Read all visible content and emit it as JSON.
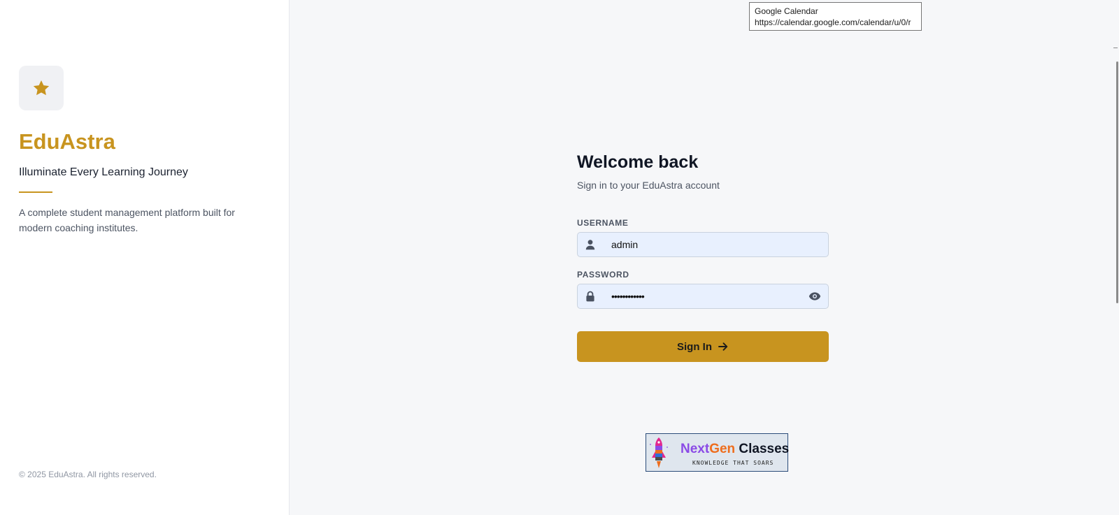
{
  "brand": {
    "logo_icon": "star-icon",
    "name": "EduAstra",
    "tagline": "Illuminate Every Learning Journey",
    "description": "A complete student management platform built for modern coaching institutes.",
    "copyright": "© 2025 EduAstra. All rights reserved.",
    "accent_color": "#c8941f"
  },
  "login": {
    "title": "Welcome back",
    "subtitle": "Sign in to your EduAstra account",
    "username_label": "USERNAME",
    "username_value": "admin",
    "username_icon": "user-icon",
    "password_label": "PASSWORD",
    "password_value": "••••••••••••",
    "password_icon": "lock-icon",
    "toggle_icon": "eye-icon",
    "submit_label": "Sign In",
    "submit_icon": "arrow-right-icon"
  },
  "banner": {
    "title_part1": "Next",
    "title_part2": "Gen",
    "title_part3": " Classes",
    "subtitle": "KNOWLEDGE THAT SOARS",
    "icon": "rocket-icon"
  },
  "tooltip": {
    "title": "Google Calendar",
    "url": "https://calendar.google.com/calendar/u/0/r"
  }
}
